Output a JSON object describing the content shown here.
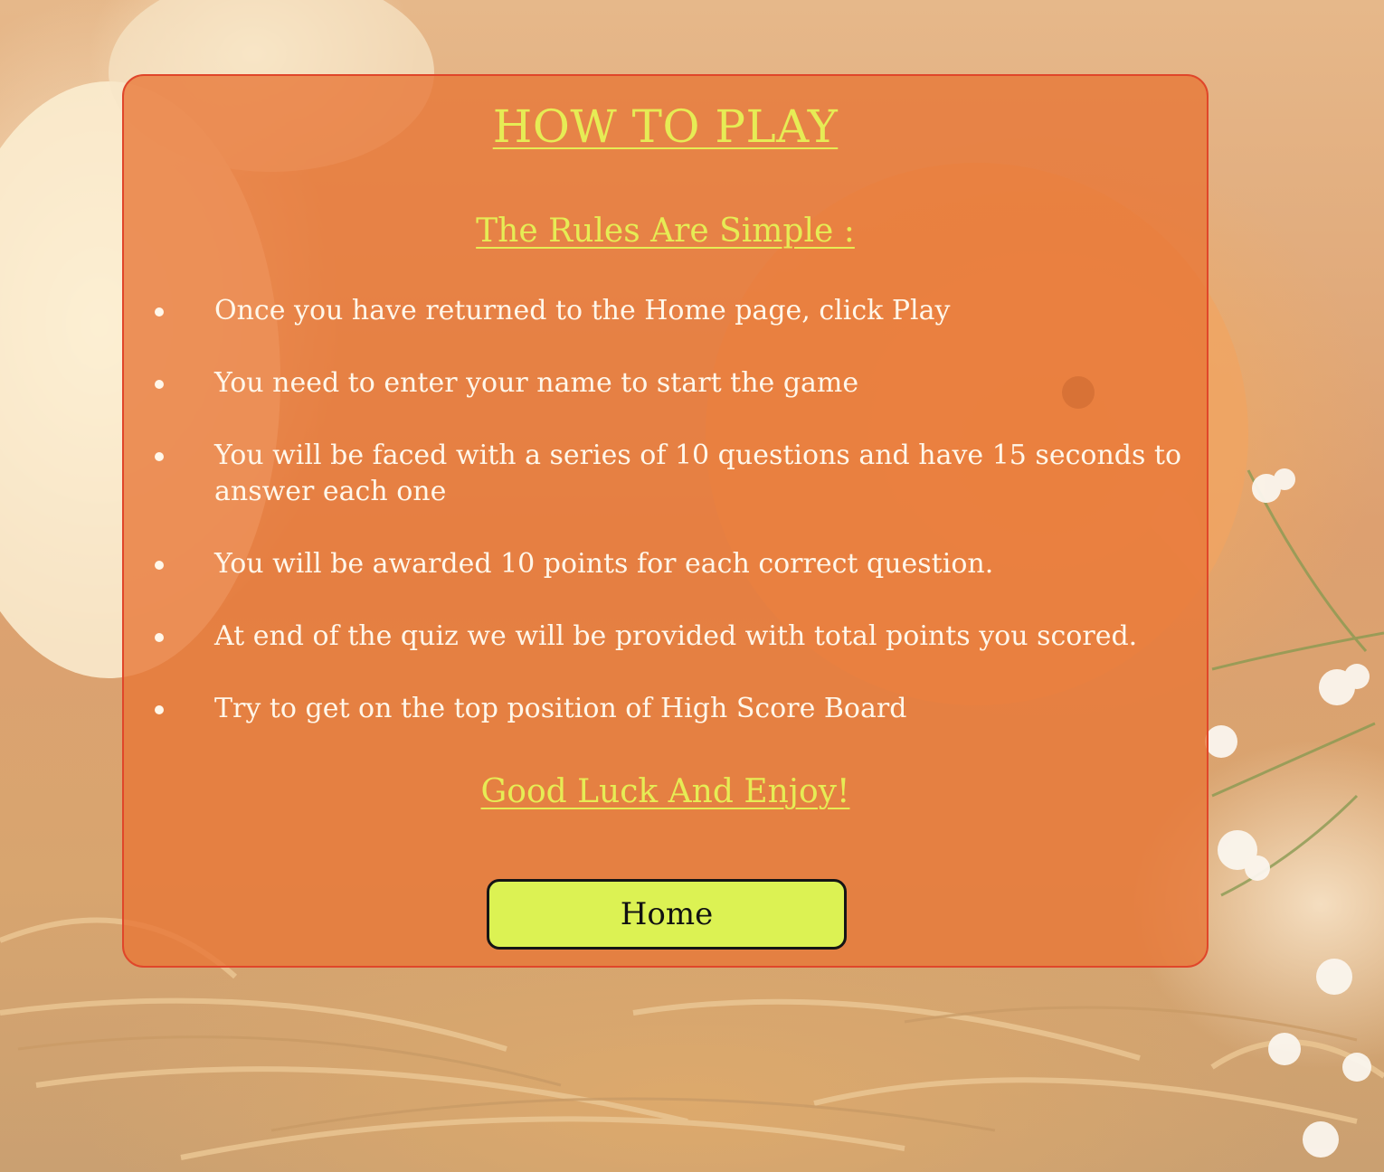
{
  "page": {
    "title": "HOW TO PLAY",
    "subtitle": "The Rules Are Simple :",
    "rules": [
      "Once you have returned to the Home page, click Play",
      "You need to enter your name to start the game",
      "You will be faced with a series of 10 questions and have 15 seconds to answer each one",
      "You will be awarded 10 points for each correct question.",
      "At end of the quiz we will be provided with total points you scored.",
      "Try to get on the top position of High Score Board"
    ],
    "closing": "Good Luck And Enjoy!",
    "home_label": "Home"
  },
  "colors": {
    "panel": "#e87636",
    "panel_border": "#e0462a",
    "heading": "#e6ec55",
    "rule_text": "#fff7ea",
    "button": "#dcf253",
    "button_border": "#151515"
  },
  "background": {
    "description_icon": "chicks-in-nest-photo"
  }
}
